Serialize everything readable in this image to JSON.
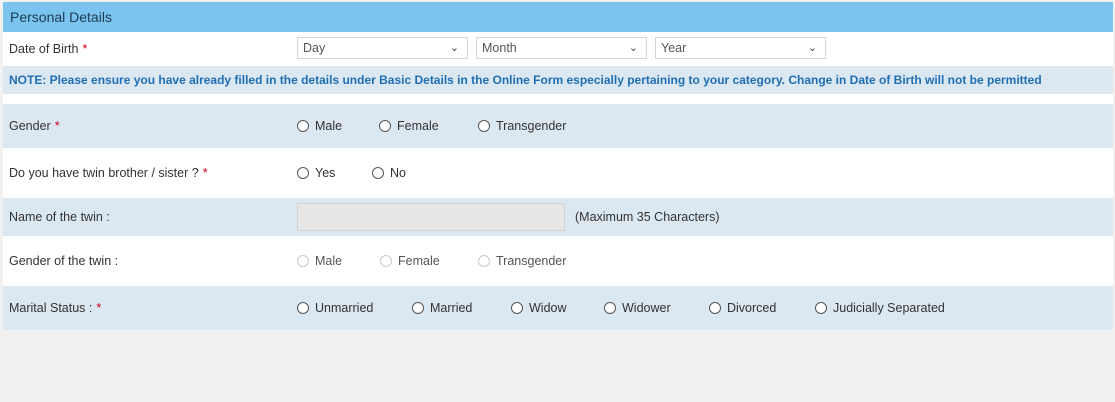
{
  "section_title": "Personal Details",
  "dob": {
    "label": "Date of Birth",
    "required": "*",
    "day": "Day",
    "month": "Month",
    "year": "Year"
  },
  "note": "NOTE: Please ensure you have already filled in the details under Basic Details in the Online Form especially pertaining to your category. Change in Date of Birth will not be permitted",
  "gender": {
    "label": "Gender",
    "required": "*",
    "options": [
      "Male",
      "Female",
      "Transgender"
    ]
  },
  "twin": {
    "label": "Do you have twin brother / sister ?",
    "required": "*",
    "options": [
      "Yes",
      "No"
    ]
  },
  "twin_name": {
    "label": "Name of the twin :",
    "hint": "(Maximum 35 Characters)",
    "value": ""
  },
  "twin_gender": {
    "label": "Gender of the twin :",
    "options": [
      "Male",
      "Female",
      "Transgender"
    ]
  },
  "marital": {
    "label": "Marital Status :",
    "required": "*",
    "options": [
      "Unmarried",
      "Married",
      "Widow",
      "Widower",
      "Divorced",
      "Judicially Separated"
    ]
  },
  "colors": {
    "header_bg": "#7bc4ef",
    "alt_row_bg": "#dbe7f1",
    "note_text": "#1f6fb5",
    "required_star": "#d0021b"
  },
  "icons": {
    "dropdown": "chevron-down-icon"
  }
}
